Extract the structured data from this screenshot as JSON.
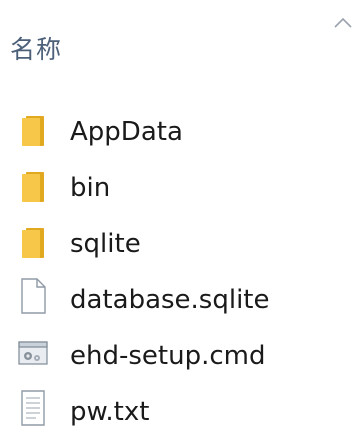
{
  "header": {
    "column_name": "名称",
    "sort_icon": "chevron-up-icon"
  },
  "files": [
    {
      "name": "AppData",
      "icon": "folder-icon"
    },
    {
      "name": "bin",
      "icon": "folder-icon"
    },
    {
      "name": "sqlite",
      "icon": "folder-icon"
    },
    {
      "name": "database.sqlite",
      "icon": "file-icon"
    },
    {
      "name": "ehd-setup.cmd",
      "icon": "cmd-script-icon"
    },
    {
      "name": "pw.txt",
      "icon": "text-file-icon"
    }
  ],
  "colors": {
    "header_text": "#4c607a",
    "folder": "#f7c74a",
    "folder_dark": "#e0a91f",
    "text": "#1a1a1a"
  }
}
